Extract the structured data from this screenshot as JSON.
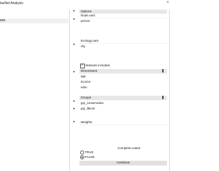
{
  "window": {
    "title": "lavNet Analysis",
    "close_glyph": "×"
  },
  "left": {
    "cases_label": "ses"
  },
  "buttons": {
    "arrow": "▸"
  },
  "options": {
    "header": "Options",
    "node_vars_label": "Node.vars",
    "node_vars_values": [
      "person"
    ],
    "ecology_vars_label": "Ecology.vars",
    "ecology_vars_values": [
      "city"
    ],
    "network_included_label": "Network included",
    "network_included_checked": true
  },
  "dimensions": {
    "header": "Dimensions",
    "values": [
      "age",
      "income",
      "educ"
    ]
  },
  "groups": {
    "header": "Groups",
    "values": [
      "grp_conservative",
      "grp_liberal"
    ]
  },
  "weights": {
    "label": "Weights"
  },
  "complete_cases": {
    "label": "Complete.cases",
    "options": [
      "TRUE",
      "FALSE"
    ],
    "selected": "FALSE"
  },
  "continue_label": "Continue",
  "icons": {
    "app": "app-icon",
    "close": "close-icon",
    "arrow": "arrow-right-icon",
    "check": "checkmark-icon"
  }
}
